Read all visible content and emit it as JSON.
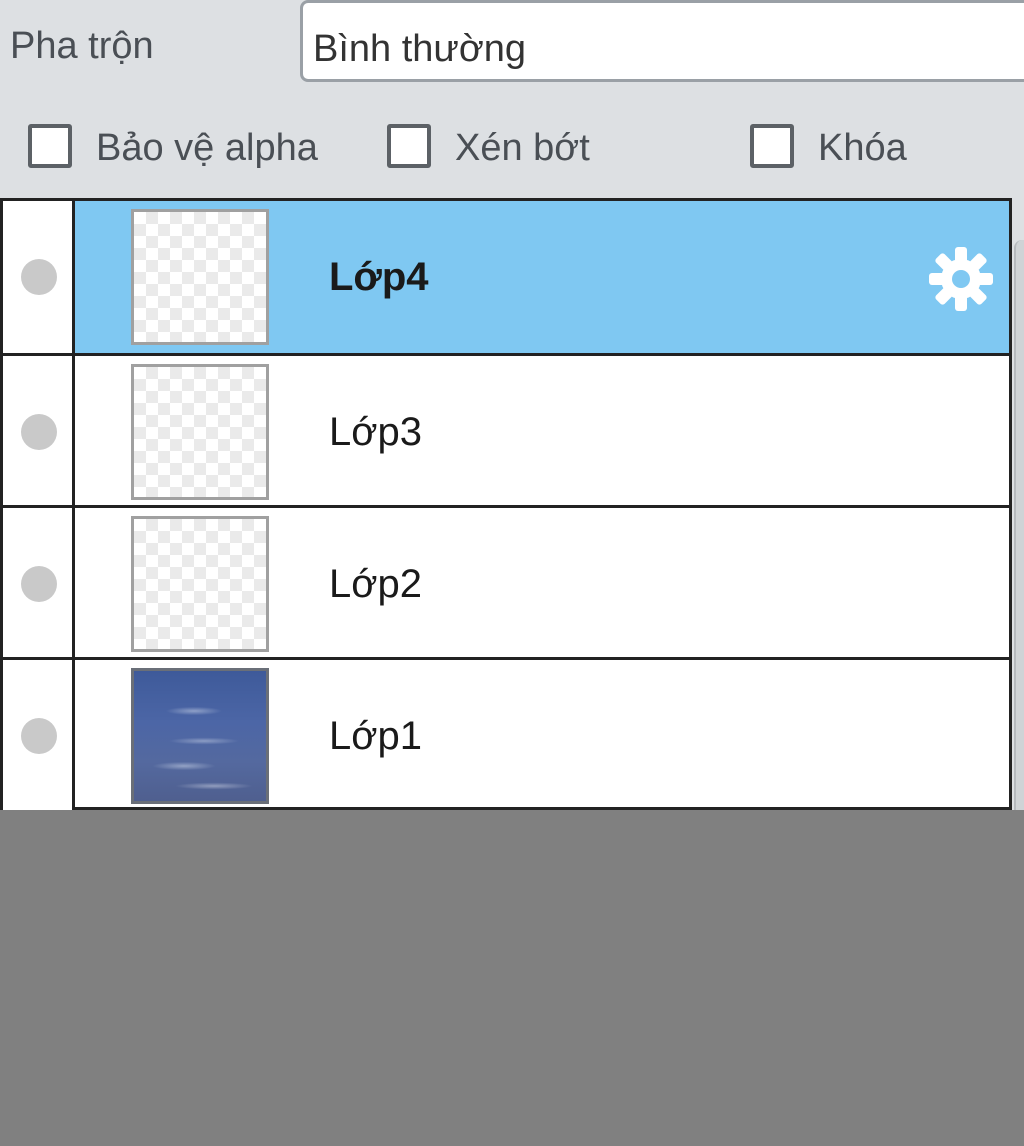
{
  "blend": {
    "label": "Pha trộn",
    "value": "Bình thường"
  },
  "options": [
    {
      "label": "Bảo vệ alpha",
      "checked": false
    },
    {
      "label": "Xén bớt",
      "checked": false
    },
    {
      "label": "Khóa",
      "checked": false
    }
  ],
  "layers": [
    {
      "name": "Lớp4",
      "selected": true,
      "thumbnail": "transparent",
      "visibility_icon": "visibility-dot-icon"
    },
    {
      "name": "Lớp3",
      "selected": false,
      "thumbnail": "transparent",
      "visibility_icon": "visibility-dot-icon"
    },
    {
      "name": "Lớp2",
      "selected": false,
      "thumbnail": "transparent",
      "visibility_icon": "visibility-dot-icon"
    },
    {
      "name": "Lớp1",
      "selected": false,
      "thumbnail": "sky-image",
      "visibility_icon": "visibility-dot-icon"
    }
  ],
  "icons": {
    "layer_settings": "gear-icon"
  },
  "colors": {
    "selected_row": "#7fc8f2",
    "panel_background": "#dde0e3",
    "empty_area": "#808080"
  }
}
